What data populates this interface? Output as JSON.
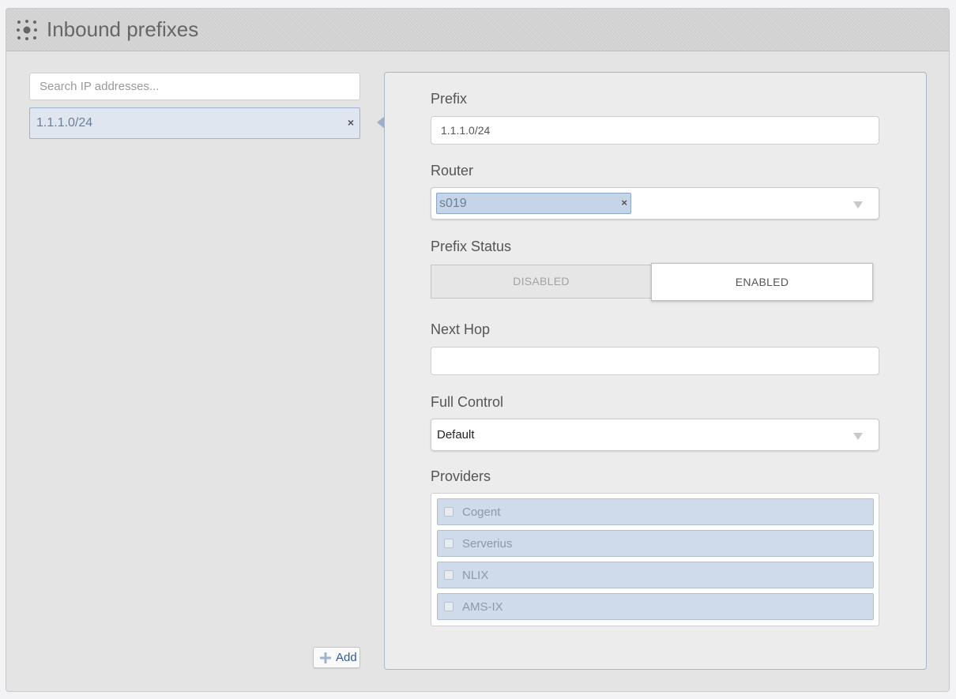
{
  "header": {
    "title": "Inbound prefixes",
    "icon": "dots-cluster-icon"
  },
  "sidebar": {
    "search_placeholder": "Search IP addresses...",
    "items": [
      {
        "label": "1.1.1.0/24",
        "remove_glyph": "×",
        "selected": true
      }
    ],
    "add_label": "Add",
    "add_icon": "plus-icon"
  },
  "form": {
    "prefix": {
      "label": "Prefix",
      "value": "1.1.1.0/24"
    },
    "router": {
      "label": "Router",
      "tags": [
        {
          "label": "s019",
          "remove_glyph": "×"
        }
      ]
    },
    "prefix_status": {
      "label": "Prefix Status",
      "options": [
        "DISABLED",
        "ENABLED"
      ],
      "selected": "ENABLED"
    },
    "next_hop": {
      "label": "Next Hop",
      "value": ""
    },
    "full_control": {
      "label": "Full Control",
      "value": "Default"
    },
    "providers": {
      "label": "Providers",
      "items": [
        {
          "label": "Cogent",
          "checked": false
        },
        {
          "label": "Serverius",
          "checked": false
        },
        {
          "label": "NLIX",
          "checked": false
        },
        {
          "label": "AMS-IX",
          "checked": false
        }
      ]
    }
  },
  "colors": {
    "selection_fill": "#dfe6f0",
    "tag_fill": "#c6d4e7",
    "link": "#2e5a9e"
  }
}
